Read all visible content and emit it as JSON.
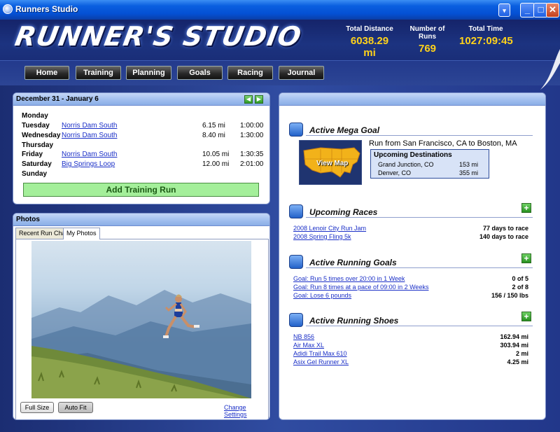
{
  "window": {
    "title": "Runners Studio",
    "buttons": {
      "dropdown": "▾",
      "minimize": "_",
      "maximize": "□",
      "close": "✕"
    }
  },
  "header": {
    "logo": "RUNNER'S STUDIO",
    "stats": [
      {
        "label": "Total Distance",
        "value": "6038.29 mi"
      },
      {
        "label": "Number of Runs",
        "value": "769"
      },
      {
        "label": "Total Time",
        "value": "1027:09:45"
      }
    ]
  },
  "nav": [
    "Home",
    "Training",
    "Planning",
    "Goals",
    "Racing",
    "Journal"
  ],
  "training": {
    "date_range": "December 31 - January 6",
    "prev_icon": "◀",
    "next_icon": "▶",
    "rows": [
      {
        "day": "Monday",
        "route": "",
        "distance": "",
        "time": ""
      },
      {
        "day": "Tuesday",
        "route": "Norris Dam South",
        "distance": "6.15 mi",
        "time": "1:00:00"
      },
      {
        "day": "Wednesday",
        "route": "Norris Dam South",
        "distance": "8.40 mi",
        "time": "1:30:00"
      },
      {
        "day": "Thursday",
        "route": "",
        "distance": "",
        "time": ""
      },
      {
        "day": "Friday",
        "route": "Norris Dam South",
        "distance": "10.05 mi",
        "time": "1:30:35"
      },
      {
        "day": "Saturday",
        "route": "Big Springs Loop",
        "distance": "12.00 mi",
        "time": "2:01:00"
      },
      {
        "day": "Sunday",
        "route": "",
        "distance": "",
        "time": ""
      }
    ],
    "add_button": "Add Training Run"
  },
  "photos": {
    "title": "Photos",
    "tabs": [
      "Recent Run Chart",
      "My Photos"
    ],
    "active_tab": "My Photos",
    "full_size": "Full Size",
    "auto_fit": "Auto Fit",
    "change_settings": "Change Settings"
  },
  "dashboard": {
    "mega_goal": {
      "title": "Active Mega Goal",
      "description": "Run from San Francisco, CA to Boston, MA",
      "map_label": "View Map",
      "destinations_title": "Upcoming Destinations",
      "destinations": [
        {
          "place": "Grand Junction, CO",
          "distance": "153 mi"
        },
        {
          "place": "Denver, CO",
          "distance": "355 mi"
        }
      ]
    },
    "races": {
      "title": "Upcoming Races",
      "items": [
        {
          "name": "2008 Lenoir City Run Jam",
          "info": "77 days to race"
        },
        {
          "name": "2008 Spring Fling 5k",
          "info": "140 days to race"
        }
      ]
    },
    "goals": {
      "title": "Active Running Goals",
      "items": [
        {
          "name": "Goal: Run 5 times over 20:00 in 1 Week",
          "info": "0 of 5"
        },
        {
          "name": "Goal: Run 8 times at a pace of 09:00 in 2 Weeks",
          "info": "2 of 8"
        },
        {
          "name": "Goal: Lose 6 pounds",
          "info": "156 / 150 lbs"
        }
      ]
    },
    "shoes": {
      "title": "Active Running Shoes",
      "items": [
        {
          "name": "NB 856",
          "info": "162.94 mi"
        },
        {
          "name": "Air Max XL",
          "info": "303.94 mi"
        },
        {
          "name": "Adidi Trail Max 610",
          "info": "2 mi"
        },
        {
          "name": "Asix Gel Runner XL",
          "info": "4.25 mi"
        }
      ]
    },
    "plus_icon": "+"
  },
  "colors": {
    "accent": "#ffd21a",
    "link": "#1a2fc7",
    "add_button_bg": "#a4ef9a"
  }
}
